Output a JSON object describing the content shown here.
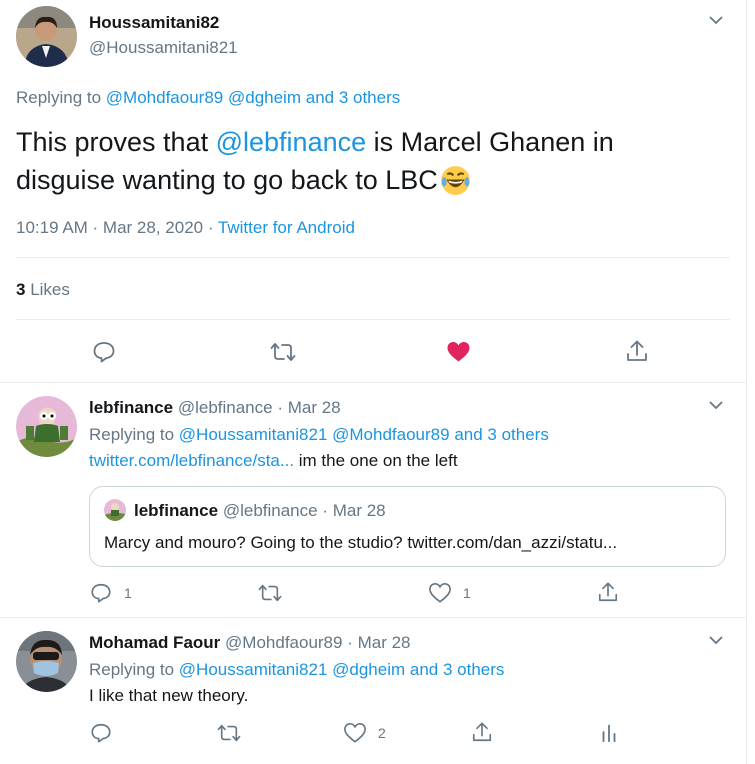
{
  "main_tweet": {
    "display_name": "Houssamitani82",
    "handle": "@Houssamitani821",
    "replying_label": "Replying to",
    "replying_user1": "@Mohdfaour89",
    "replying_user2": "@dgheim",
    "replying_others": "and 3 others",
    "text_before": "This proves that",
    "mention": "@lebfinance",
    "text_after_line1": "is Marcel Ghanen in",
    "text_line2": "disguise wanting to go back to LBC",
    "timestamp": "10:19 AM · Mar 28, 2020 ·",
    "source": "Twitter for Android",
    "likes_count": "3",
    "likes_label": "Likes"
  },
  "reply1": {
    "display_name": "lebfinance",
    "handle": "@lebfinance",
    "date": "· Mar 28",
    "replying_label": "Replying to",
    "replying_user1": "@Houssamitani821",
    "replying_user2": "@Mohdfaour89",
    "replying_others": "and 3 others",
    "link": "twitter.com/lebfinance/sta...",
    "text": " im the one on the left",
    "reply_count": "1",
    "like_count": "1",
    "quote": {
      "display_name": "lebfinance",
      "handle": "@lebfinance",
      "date": "· Mar 28",
      "text": "Marcy and mouro? Going to the studio? twitter.com/dan_azzi/statu..."
    }
  },
  "reply2": {
    "display_name": "Mohamad Faour",
    "handle": "@Mohdfaour89",
    "date": "· Mar 28",
    "replying_label": "Replying to",
    "replying_user1": "@Houssamitani821",
    "replying_user2": "@dgheim",
    "replying_others": "and 3 others",
    "text": "I like that new theory.",
    "like_count": "2"
  },
  "icons": [
    "chevron-down-icon",
    "reply-icon",
    "retweet-icon",
    "heart-icon",
    "share-icon",
    "analytics-icon",
    "laughing-emoji-icon"
  ],
  "colors": {
    "link": "#1b95e0",
    "liked": "#e0245e",
    "muted": "#657786",
    "border": "#e6ecf0"
  }
}
